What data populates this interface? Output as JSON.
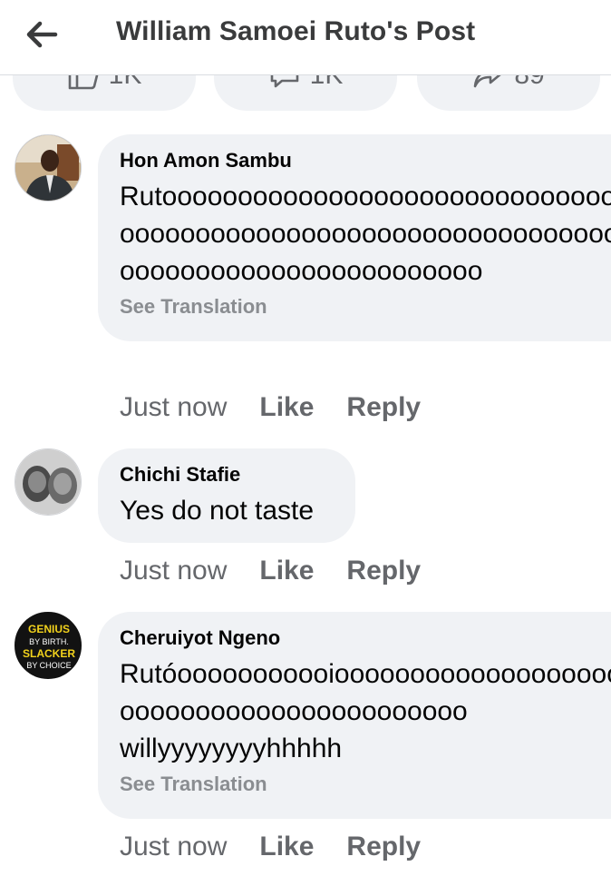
{
  "header": {
    "title": "William Samoei Ruto's Post",
    "back_icon": "arrow-left-icon"
  },
  "reactions": {
    "like": {
      "count": "1K",
      "icon": "thumbs-up-icon"
    },
    "comment": {
      "count": "1K",
      "icon": "comment-icon"
    },
    "share": {
      "count": "89",
      "icon": "share-icon"
    }
  },
  "comments": [
    {
      "author": "Hon Amon Sambu",
      "lines": [
        "Rutoooooooooooooooooooooooooooooo",
        "oooooooooooooooooooooooooooooooooo",
        "oooooooooooooooooooooooo"
      ],
      "translate": "See Translation",
      "time": "Just now",
      "like": "Like",
      "reply": "Reply"
    },
    {
      "author": "Chichi Stafie",
      "lines": [
        "Yes do not taste"
      ],
      "time": "Just now",
      "like": "Like",
      "reply": "Reply"
    },
    {
      "author": "Cheruiyot Ngeno",
      "lines": [
        "Rutóooooooooooioooooooooooooooooooo",
        "ooooooooooooooooooooooo",
        "willyyyyyyyyhhhhh"
      ],
      "translate": "See Translation",
      "time": "Just now",
      "like": "Like",
      "reply": "Reply",
      "avatar_text": [
        "GENIUS",
        "BY BIRTH.",
        "SLACKER",
        "BY CHOICE"
      ]
    }
  ],
  "colors": {
    "bubble": "#f0f2f5",
    "meta": "#65676b",
    "divider": "#dadde1"
  }
}
